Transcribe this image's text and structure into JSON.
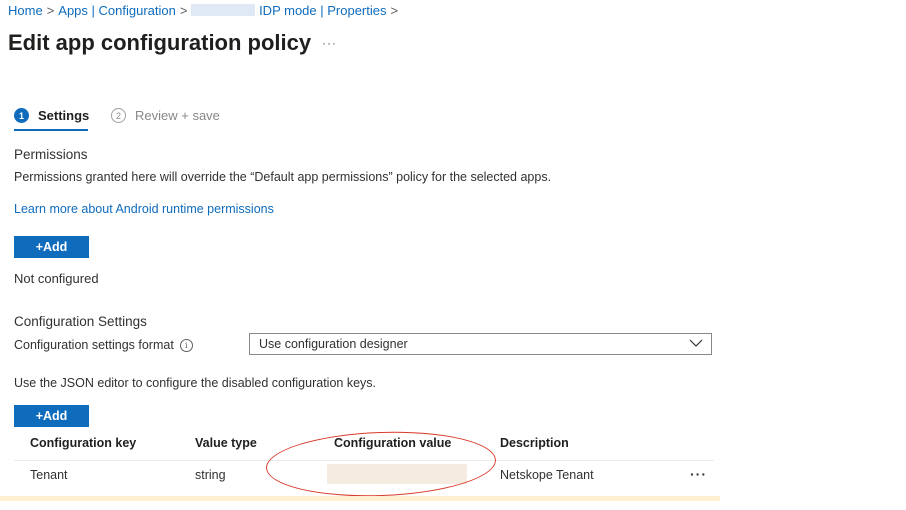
{
  "breadcrumb": {
    "items": [
      "Home",
      "Apps | Configuration",
      "IDP mode | Properties"
    ],
    "separator": ">"
  },
  "page": {
    "title": "Edit app configuration policy",
    "more": "···"
  },
  "steps": [
    {
      "number": "1",
      "label": "Settings",
      "active": true
    },
    {
      "number": "2",
      "label": "Review + save",
      "active": false
    }
  ],
  "permissions": {
    "heading": "Permissions",
    "description": "Permissions granted here will override the “Default app permissions” policy for the selected apps.",
    "link": "Learn more about Android runtime permissions",
    "add_label": "+Add",
    "status": "Not configured"
  },
  "config": {
    "heading": "Configuration Settings",
    "format_label": "Configuration settings format",
    "format_value": "Use configuration designer",
    "json_hint": "Use the JSON editor to configure the disabled configuration keys.",
    "add_label": "+Add"
  },
  "table": {
    "columns": [
      "Configuration key",
      "Value type",
      "Configuration value",
      "Description"
    ],
    "rows": [
      {
        "key": "Tenant",
        "type": "string",
        "value": "",
        "description": "Netskope Tenant",
        "more": "···"
      }
    ]
  },
  "colors": {
    "accent": "#0f6cbd",
    "annotation": "#d93b2b"
  }
}
